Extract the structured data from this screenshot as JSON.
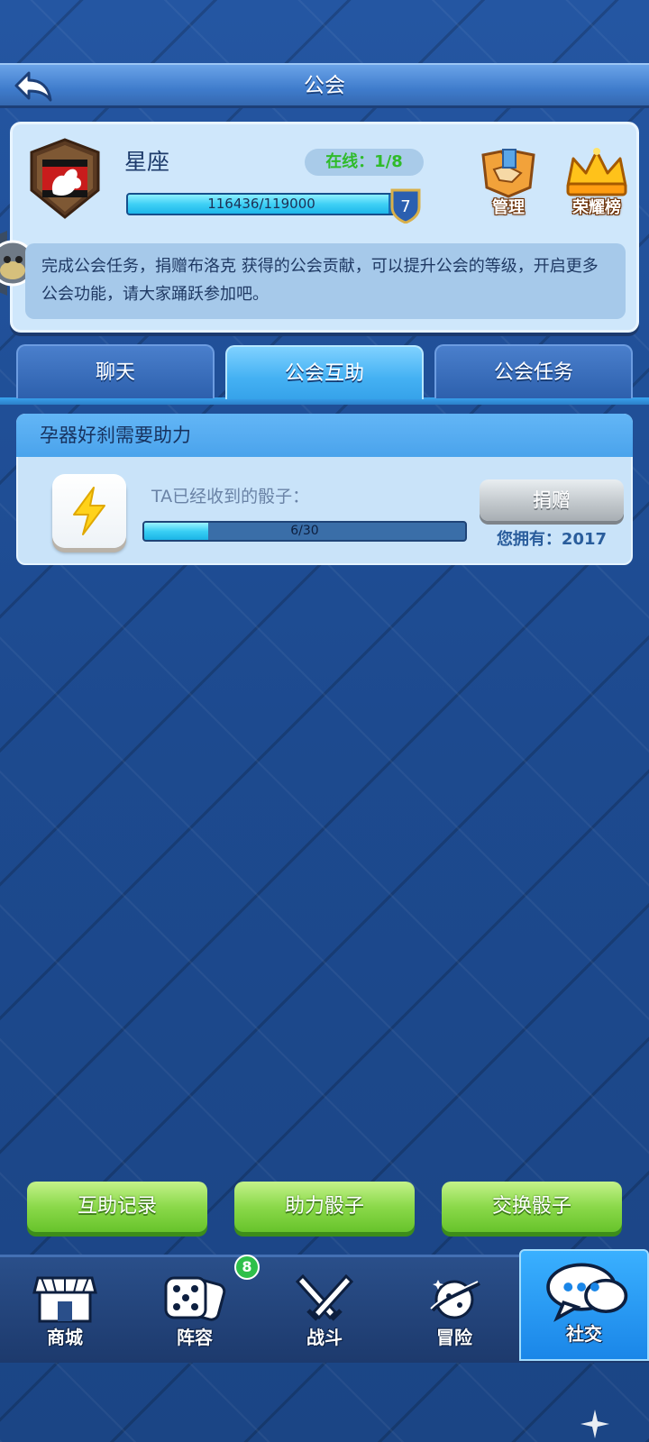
{
  "header": {
    "title": "公会"
  },
  "guild": {
    "name": "星座",
    "online": "在线：1/8",
    "exp_text": "116436/119000",
    "exp_progress": 0.978,
    "level": "7",
    "manage_label": "管理",
    "honor_label": "荣耀榜",
    "description": "完成公会任务，捐赠布洛克 获得的公会贡献，可以提升公会的等级，开启更多公会功能，请大家踊跃参加吧。"
  },
  "tabs": [
    {
      "label": "聊天",
      "active": false
    },
    {
      "label": "公会互助",
      "active": true
    },
    {
      "label": "公会任务",
      "active": false
    }
  ],
  "request": {
    "title": "孕器好刹需要助力",
    "received_label": "TA已经收到的骰子：",
    "progress_text": "6/30",
    "progress": 0.2,
    "donate_label": "捐赠",
    "own_text": "您拥有：2017"
  },
  "actions": {
    "records": "互助记录",
    "help_dice": "助力骰子",
    "exchange_dice": "交换骰子"
  },
  "nav": [
    {
      "label": "商城",
      "icon": "shop-icon"
    },
    {
      "label": "阵容",
      "icon": "dice-icon",
      "badge": "8"
    },
    {
      "label": "战斗",
      "icon": "swords-icon"
    },
    {
      "label": "冒险",
      "icon": "adventure-icon"
    },
    {
      "label": "社交",
      "icon": "chat-icon",
      "active": true
    }
  ],
  "colors": {
    "accent_blue": "#44b1f3",
    "green_button": "#8bd94a",
    "online_green": "#2fbb2a"
  }
}
